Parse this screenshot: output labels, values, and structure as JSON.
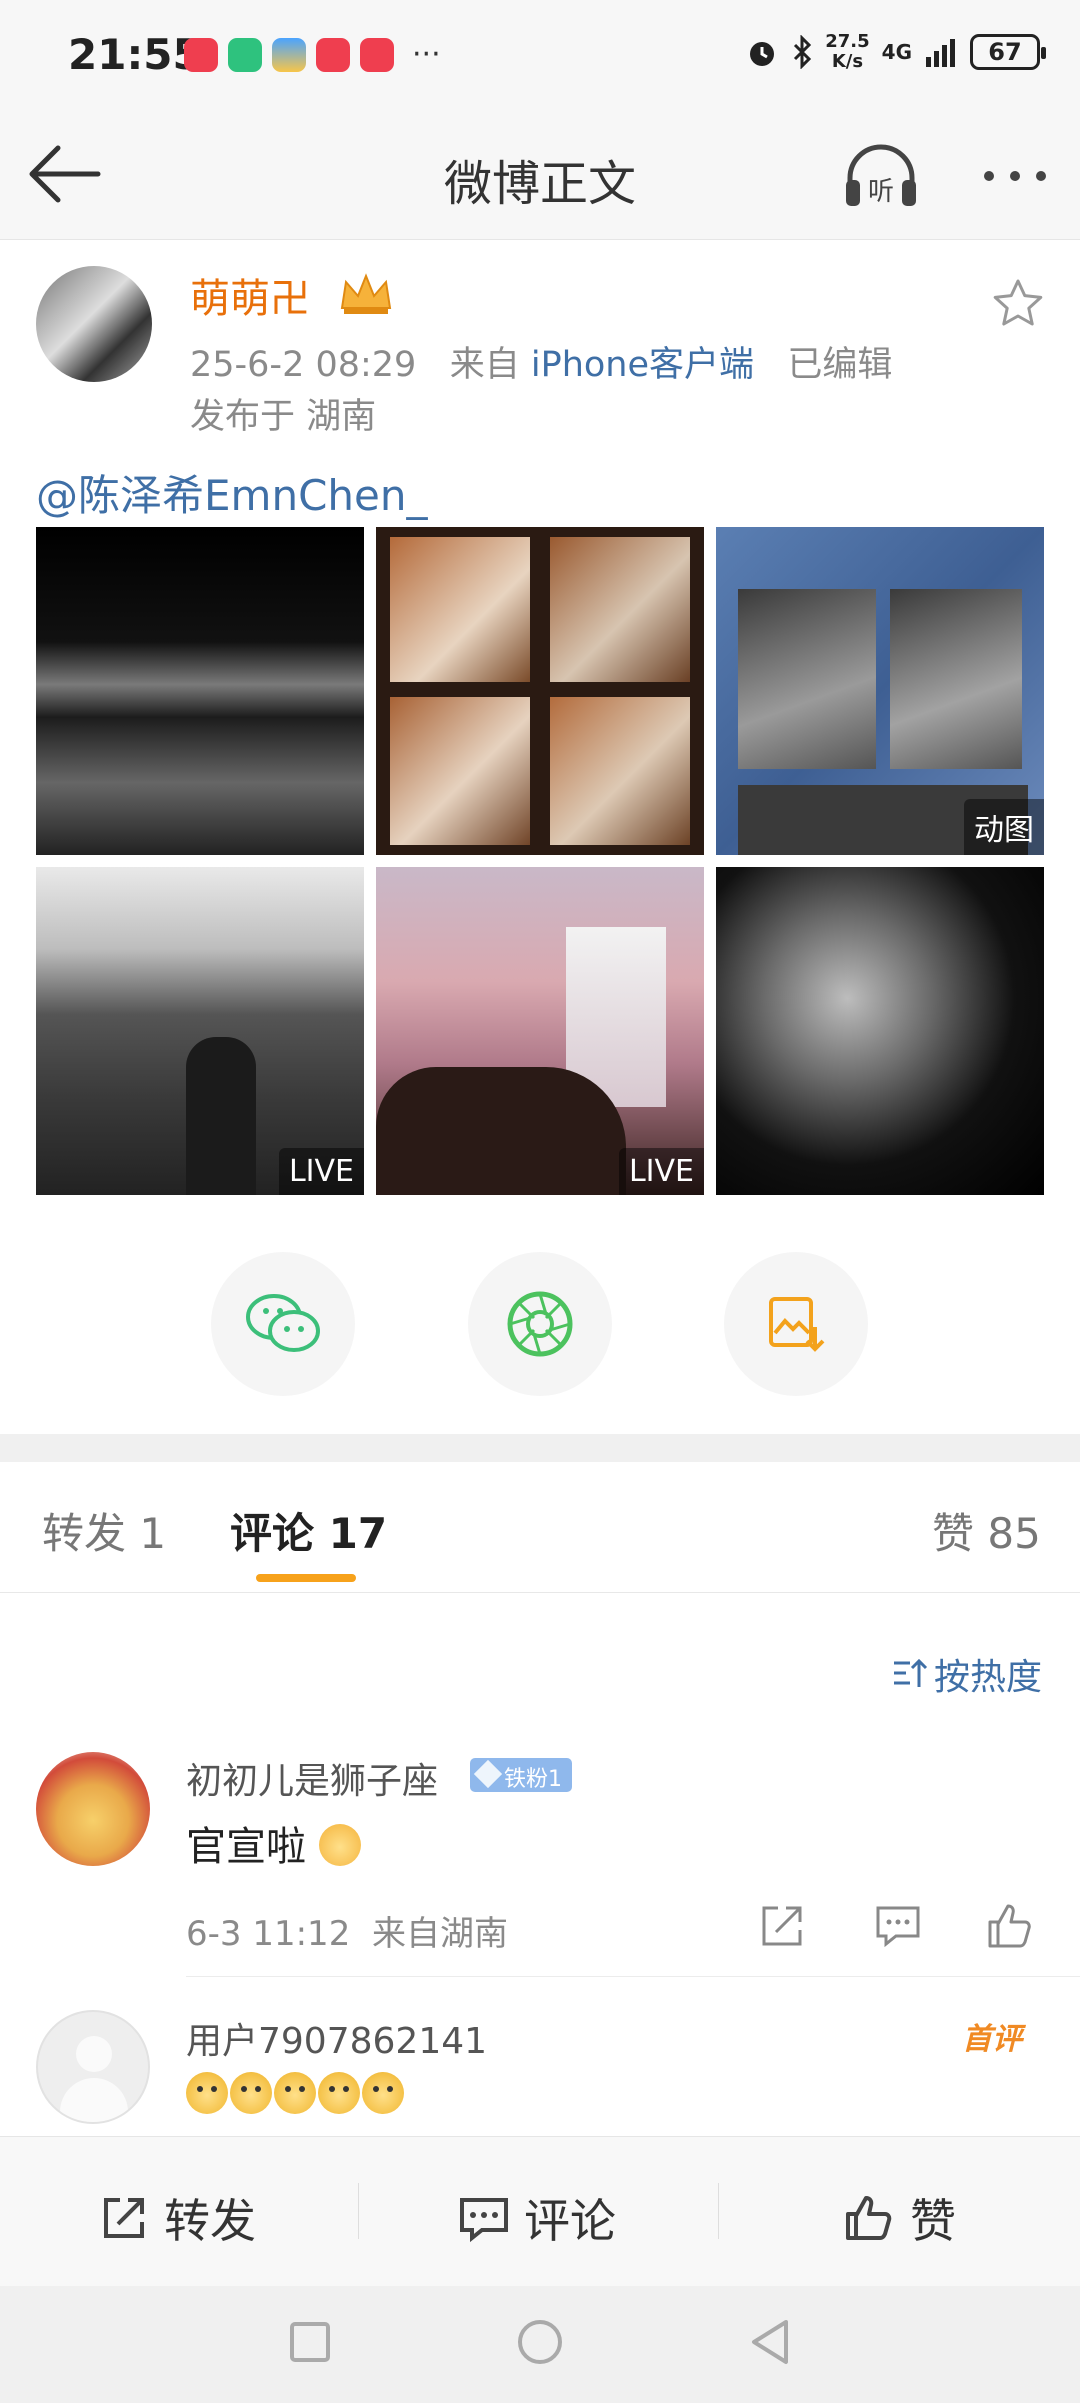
{
  "status_bar": {
    "time": "21:55",
    "more_dots": "···",
    "net_speed": "27.5",
    "net_unit": "K/s",
    "network": "4G",
    "battery": "67"
  },
  "nav": {
    "title": "微博正文",
    "listen_label": "听"
  },
  "post": {
    "author": "萌萌卍",
    "date": "25-6-2 08:29",
    "from_prefix": "来自",
    "source": "iPhone客户端",
    "edited": "已编辑",
    "location": "发布于 湖南",
    "mention": "@陈泽希EmnChen_",
    "photos": [
      {
        "badge": ""
      },
      {
        "badge": ""
      },
      {
        "badge": "动图"
      },
      {
        "badge": "LIVE"
      },
      {
        "badge": "LIVE"
      },
      {
        "badge": ""
      }
    ]
  },
  "share": {
    "wechat": "wechat-icon",
    "moments": "moments-icon",
    "save_image": "save-image-icon"
  },
  "tabs": {
    "repost": "转发 1",
    "comments": "评论 17",
    "likes": "赞 85"
  },
  "sort_label": "按热度",
  "comments": [
    {
      "name": "初初儿是狮子座",
      "badge": "铁粉1",
      "text": "官宣啦",
      "time": "6-3 11:12",
      "location": "来自湖南"
    },
    {
      "name": "用户7907862141",
      "tag": "首评",
      "emoji_count": 5
    }
  ],
  "actions": {
    "repost": "转发",
    "comment": "评论",
    "like": "赞"
  },
  "colors": {
    "accent": "#f7a21b",
    "link": "#3f6fa6",
    "author": "#e8700a"
  }
}
